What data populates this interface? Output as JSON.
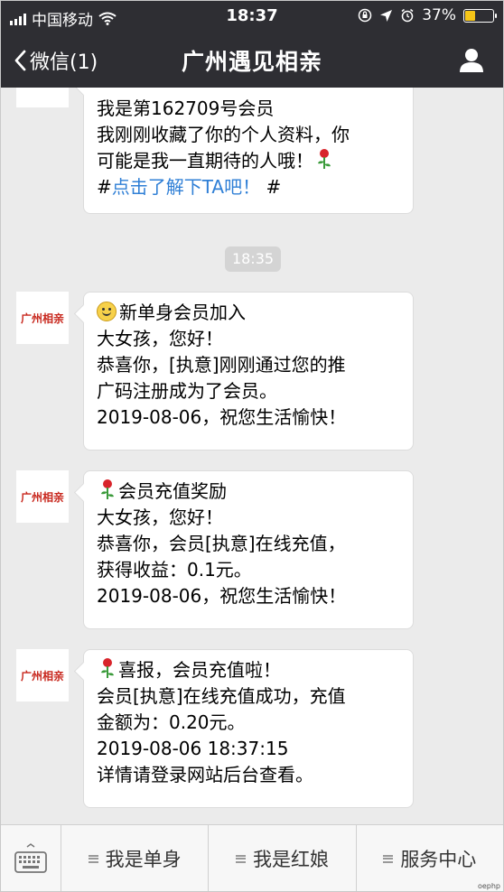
{
  "status_bar": {
    "carrier": "中国移动",
    "time": "18:37",
    "battery": "37%",
    "battery_level": 0.37,
    "icons": [
      "signal-icon",
      "wifi-icon",
      "rotation-lock-icon",
      "location-icon",
      "alarm-icon",
      "battery-icon"
    ]
  },
  "nav": {
    "back_label": "微信(1)",
    "title": "广州遇见相亲",
    "profile_icon": "person-icon"
  },
  "avatar_text": "广州相亲",
  "messages": [
    {
      "id": "msg-partial",
      "lines": [
        {
          "text": "我是第162709号会员"
        },
        {
          "text": "我刚刚收藏了你的个人资料，你"
        },
        {
          "text": "可能是我一直期待的人哦！"
        },
        {
          "prefix": "#",
          "link": "点击了解下TA吧！",
          "suffix": " #"
        }
      ]
    },
    {
      "id": "msg-new-member",
      "lines": [
        {
          "text": "新单身会员加入"
        },
        {
          "text": "大女孩，您好！"
        },
        {
          "text": "恭喜你，[执意]刚刚通过您的推"
        },
        {
          "text": "广码注册成为了会员。"
        },
        {
          "text": "2019-08-06，祝您生活愉快！"
        }
      ]
    },
    {
      "id": "msg-recharge-reward",
      "lines": [
        {
          "text": "会员充值奖励"
        },
        {
          "text": "大女孩，您好！"
        },
        {
          "text": "恭喜你，会员[执意]在线充值，"
        },
        {
          "text": "获得收益：0.1元。"
        },
        {
          "text": "2019-08-06，祝您生活愉快！"
        }
      ]
    },
    {
      "id": "msg-recharge-report",
      "lines": [
        {
          "text": "喜报，会员充值啦！"
        },
        {
          "text": "会员[执意]在线充值成功，充值"
        },
        {
          "text": "金额为：0.20元。"
        },
        {
          "text": "2019-08-06 18:37:15"
        },
        {
          "text": "详情请登录网站后台查看。"
        }
      ]
    }
  ],
  "timestamp": "18:35",
  "menu": {
    "keyboard_icon": "keyboard-icon",
    "items": [
      {
        "label": "我是单身"
      },
      {
        "label": "我是红娘"
      },
      {
        "label": "服务中心"
      }
    ]
  },
  "watermark": "oephp",
  "colors": {
    "header_bg": "#2e2e33",
    "chat_bg": "#ebebeb",
    "link": "#2f7fd6",
    "avatar_text": "#c8281e",
    "battery_fill": "#f5c518"
  }
}
